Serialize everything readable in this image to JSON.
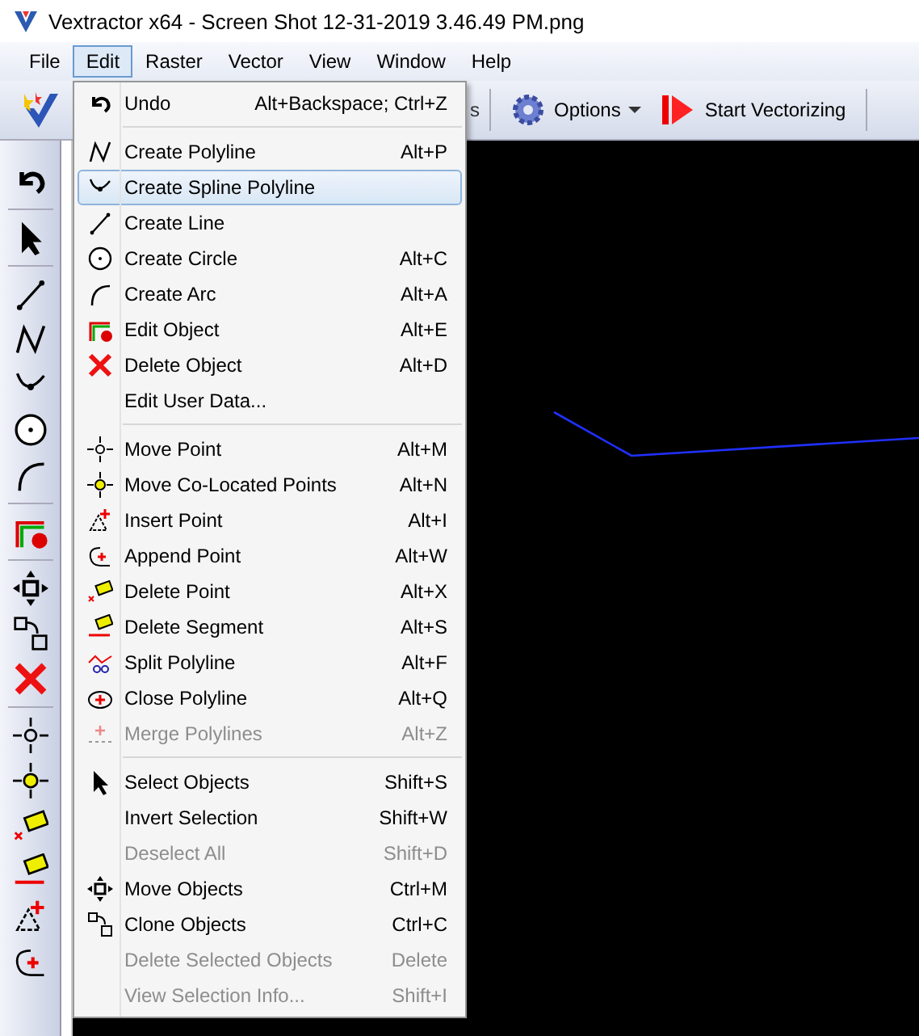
{
  "window": {
    "title": "Vextractor x64 - Screen Shot 12-31-2019 3.46.49 PM.png"
  },
  "menu_bar": [
    {
      "label": "File",
      "selected": false
    },
    {
      "label": "Edit",
      "selected": true
    },
    {
      "label": "Raster",
      "selected": false
    },
    {
      "label": "Vector",
      "selected": false
    },
    {
      "label": "View",
      "selected": false
    },
    {
      "label": "Window",
      "selected": false
    },
    {
      "label": "Help",
      "selected": false
    }
  ],
  "toolbar": {
    "partial_button": "s",
    "options_button": "Options",
    "start_button": "Start Vectorizing"
  },
  "edit_menu": [
    {
      "kind": "item",
      "label": "Undo",
      "shortcut": "Alt+Backspace; Ctrl+Z",
      "disabled": false,
      "selected": false
    },
    {
      "kind": "separator"
    },
    {
      "kind": "item",
      "label": "Create Polyline",
      "shortcut": "Alt+P",
      "disabled": false,
      "selected": false
    },
    {
      "kind": "item",
      "label": "Create Spline Polyline",
      "disabled": false,
      "selected": true
    },
    {
      "kind": "item",
      "label": "Create Line",
      "disabled": false,
      "selected": false
    },
    {
      "kind": "item",
      "label": "Create Circle",
      "shortcut": "Alt+C",
      "disabled": false,
      "selected": false
    },
    {
      "kind": "item",
      "label": "Create Arc",
      "shortcut": "Alt+A",
      "disabled": false,
      "selected": false
    },
    {
      "kind": "item",
      "label": "Edit Object",
      "shortcut": "Alt+E",
      "disabled": false,
      "selected": false
    },
    {
      "kind": "item",
      "label": "Delete Object",
      "shortcut": "Alt+D",
      "disabled": false,
      "selected": false
    },
    {
      "kind": "item",
      "label": "Edit User Data...",
      "disabled": false,
      "selected": false
    },
    {
      "kind": "separator"
    },
    {
      "kind": "item",
      "label": "Move Point",
      "shortcut": "Alt+M",
      "disabled": false,
      "selected": false
    },
    {
      "kind": "item",
      "label": "Move Co-Located Points",
      "shortcut": "Alt+N",
      "disabled": false,
      "selected": false
    },
    {
      "kind": "item",
      "label": "Insert Point",
      "shortcut": "Alt+I",
      "disabled": false,
      "selected": false
    },
    {
      "kind": "item",
      "label": "Append Point",
      "shortcut": "Alt+W",
      "disabled": false,
      "selected": false
    },
    {
      "kind": "item",
      "label": "Delete Point",
      "shortcut": "Alt+X",
      "disabled": false,
      "selected": false
    },
    {
      "kind": "item",
      "label": "Delete Segment",
      "shortcut": "Alt+S",
      "disabled": false,
      "selected": false
    },
    {
      "kind": "item",
      "label": "Split Polyline",
      "shortcut": "Alt+F",
      "disabled": false,
      "selected": false
    },
    {
      "kind": "item",
      "label": "Close Polyline",
      "shortcut": "Alt+Q",
      "disabled": false,
      "selected": false
    },
    {
      "kind": "item",
      "label": "Merge Polylines",
      "shortcut": "Alt+Z",
      "disabled": true,
      "selected": false
    },
    {
      "kind": "separator"
    },
    {
      "kind": "item",
      "label": "Select Objects",
      "shortcut": "Shift+S",
      "disabled": false,
      "selected": false
    },
    {
      "kind": "item",
      "label": "Invert Selection",
      "shortcut": "Shift+W",
      "disabled": false,
      "selected": false
    },
    {
      "kind": "item",
      "label": "Deselect All",
      "shortcut": "Shift+D",
      "disabled": true,
      "selected": false
    },
    {
      "kind": "item",
      "label": "Move Objects",
      "shortcut": "Ctrl+M",
      "disabled": false,
      "selected": false
    },
    {
      "kind": "item",
      "label": "Clone Objects",
      "shortcut": "Ctrl+C",
      "disabled": false,
      "selected": false
    },
    {
      "kind": "item",
      "label": "Delete Selected Objects",
      "shortcut": "Delete",
      "disabled": true,
      "selected": false
    },
    {
      "kind": "item",
      "label": "View Selection Info...",
      "shortcut": "Shift+I",
      "disabled": true,
      "selected": false
    }
  ]
}
